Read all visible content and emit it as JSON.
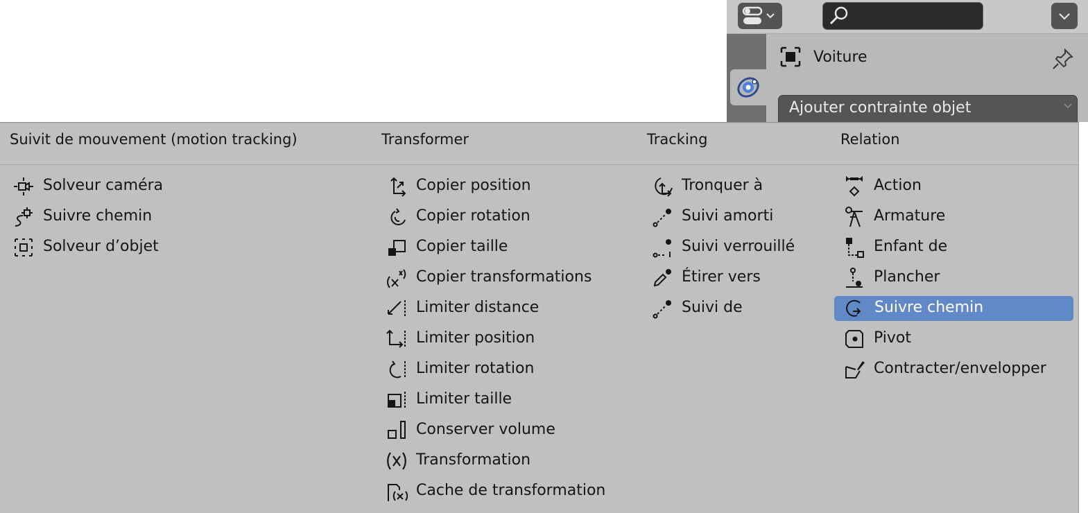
{
  "properties": {
    "object_name": "Voiture",
    "add_constraint_label": "Ajouter contrainte objet",
    "icons": {
      "editor_type": "properties-editor-icon",
      "search": "search-icon",
      "options": "chevron-down-icon",
      "constraint_tab": "object-constraint-icon",
      "object": "object-icon",
      "pin": "pin-icon"
    }
  },
  "menu": {
    "columns": [
      {
        "title": "Suivit de mouvement (motion tracking)",
        "items": [
          {
            "label": "Solveur caméra",
            "icon": "camera-solver-icon"
          },
          {
            "label": "Suivre chemin",
            "icon": "follow-track-icon"
          },
          {
            "label": "Solveur d’objet",
            "icon": "object-solver-icon"
          }
        ]
      },
      {
        "title": "Transformer",
        "items": [
          {
            "label": "Copier position",
            "icon": "copy-location-icon"
          },
          {
            "label": "Copier rotation",
            "icon": "copy-rotation-icon"
          },
          {
            "label": "Copier taille",
            "icon": "copy-scale-icon"
          },
          {
            "label": "Copier transformations",
            "icon": "copy-transforms-icon"
          },
          {
            "label": "Limiter distance",
            "icon": "limit-distance-icon"
          },
          {
            "label": "Limiter position",
            "icon": "limit-location-icon"
          },
          {
            "label": "Limiter rotation",
            "icon": "limit-rotation-icon"
          },
          {
            "label": "Limiter taille",
            "icon": "limit-scale-icon"
          },
          {
            "label": "Conserver volume",
            "icon": "maintain-volume-icon"
          },
          {
            "label": "Transformation",
            "icon": "transformation-icon"
          },
          {
            "label": "Cache de transformation",
            "icon": "transform-cache-icon"
          }
        ]
      },
      {
        "title": "Tracking",
        "items": [
          {
            "label": "Tronquer à",
            "icon": "clamp-to-icon"
          },
          {
            "label": "Suivi amorti",
            "icon": "damped-track-icon"
          },
          {
            "label": "Suivi verrouillé",
            "icon": "locked-track-icon"
          },
          {
            "label": "Étirer vers",
            "icon": "stretch-to-icon"
          },
          {
            "label": "Suivi de",
            "icon": "track-to-icon"
          }
        ]
      },
      {
        "title": "Relation",
        "items": [
          {
            "label": "Action",
            "icon": "action-icon"
          },
          {
            "label": "Armature",
            "icon": "armature-icon"
          },
          {
            "label": "Enfant de",
            "icon": "child-of-icon"
          },
          {
            "label": "Plancher",
            "icon": "floor-icon"
          },
          {
            "label": "Suivre chemin",
            "icon": "follow-path-icon",
            "highlighted": true
          },
          {
            "label": "Pivot",
            "icon": "pivot-icon"
          },
          {
            "label": "Contracter/envelopper",
            "icon": "shrinkwrap-icon"
          }
        ]
      }
    ]
  },
  "colors": {
    "menu_background": "#c0c0c0",
    "highlight": "#6189c8",
    "text": "#151515"
  }
}
